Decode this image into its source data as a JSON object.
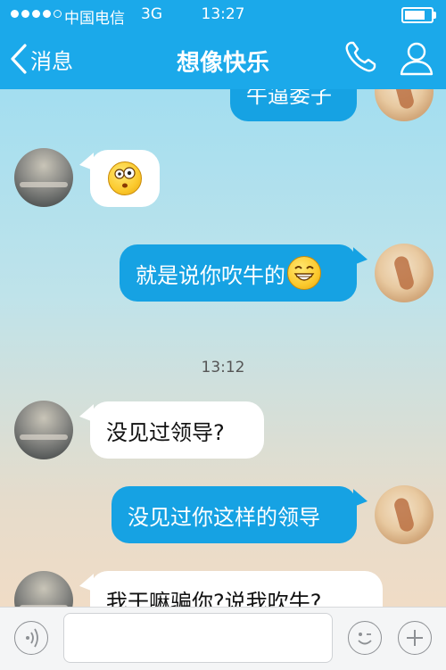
{
  "status_bar": {
    "carrier": "中国电信",
    "network": "3G",
    "time": "13:27",
    "battery_level": 0.85
  },
  "nav": {
    "back_label": "消息",
    "title": "想像快乐"
  },
  "messages": [
    {
      "side": "out",
      "text": "牛逼娄子",
      "partial": true
    },
    {
      "side": "in",
      "text": "",
      "emoji": "dizzy-face"
    },
    {
      "side": "out",
      "text": "就是说你吹牛的",
      "emoji": "grin-face"
    },
    {
      "side": "in",
      "text": "没见过领导?"
    },
    {
      "side": "out",
      "text": "没见过你这样的领导"
    },
    {
      "side": "in",
      "text": "我干嘛骗你?说我吹牛?",
      "partial": true
    }
  ],
  "timestamp": "13:12",
  "colors": {
    "accent": "#1ba9ea",
    "bubble_out": "#16a2e3",
    "bubble_in": "#ffffff"
  }
}
